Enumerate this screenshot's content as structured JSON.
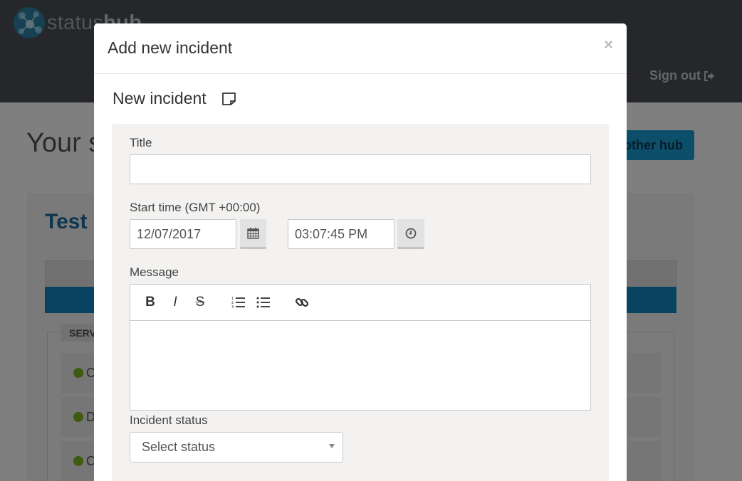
{
  "background": {
    "logo": {
      "prefix": "status",
      "suffix": "hub"
    },
    "sign_out_label": "Sign out",
    "page_title": "Your s",
    "other_hub_label": "other hub",
    "panel_title": "Test",
    "services_label": "SERV",
    "services": [
      {
        "name": "C",
        "status": "operational"
      },
      {
        "name": "D",
        "status": "operational"
      },
      {
        "name": "C",
        "status": "operational"
      }
    ]
  },
  "modal": {
    "title": "Add new incident",
    "close_label": "×",
    "section_title": "New incident",
    "form": {
      "title_label": "Title",
      "title_value": "",
      "start_time_label": "Start time (GMT +00:00)",
      "date_value": "12/07/2017",
      "time_value": "03:07:45 PM",
      "message_label": "Message",
      "message_value": "",
      "toolbar": [
        "bold-icon",
        "italic-icon",
        "strikethrough-icon",
        "ordered-list-icon",
        "bullet-list-icon",
        "link-icon"
      ],
      "status_label": "Incident status",
      "status_value": "Select status"
    }
  },
  "colors": {
    "topbar": "#4a4f56",
    "accent": "#1a9ed6",
    "status_green": "#7fb623",
    "form_bg": "#f3f2f1"
  }
}
